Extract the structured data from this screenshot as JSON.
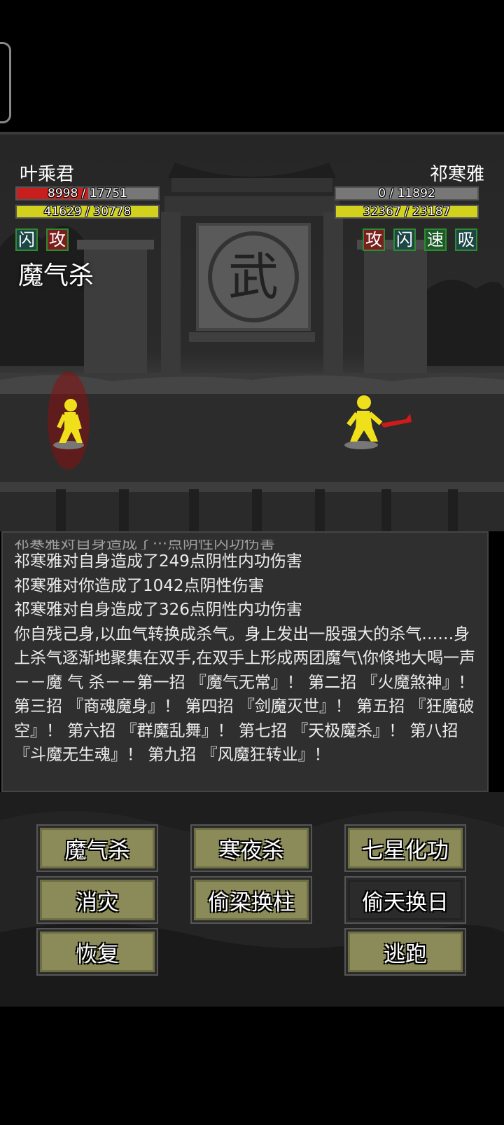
{
  "player": {
    "name": "叶乘君",
    "hp_text": "8998 / 17751",
    "hp_fraction": 0.507,
    "mp_text": "41629 / 30778",
    "mp_fraction": 1.0,
    "buffs": [
      "闪",
      "攻"
    ],
    "current_skill": "魔气杀"
  },
  "enemy": {
    "name": "祁寒雅",
    "hp_text": "0 / 11892",
    "hp_fraction": 0.0,
    "mp_text": "32367 / 23187",
    "mp_fraction": 1.0,
    "buffs": [
      "攻",
      "闪",
      "速",
      "吸"
    ]
  },
  "colors": {
    "hp": "#c81e1e",
    "mp": "#d2d21e",
    "fighter": "#f0e01c",
    "sword": "#d01a1a",
    "button": "#8b8b5a"
  },
  "battle_log": [
    "祁寒雅对自身造成了249点阴性内功伤害",
    "祁寒雅对你造成了1042点阴性伤害",
    "祁寒雅对自身造成了326点阴性内功伤害",
    "你自残己身,以血气转换成杀气。身上发出一股强大的杀气……身上杀气逐渐地聚集在双手,在双手上形成两团魔气\\你倏地大喝一声－－魔 气 杀－－第一招 『魔气无常』！ 第二招 『火魔煞神』！ 第三招 『商魂魔身』！ 第四招 『剑魔灭世』！ 第五招 『狂魔破空』！ 第六招 『群魔乱舞』！ 第七招 『天极魔杀』！ 第八招 『斗魔无生魂』！ 第九招 『风魔狂转业』！"
  ],
  "actions": {
    "mo_qi_sha": "魔气杀",
    "han_ye_sha": "寒夜杀",
    "qi_xing_hua_gong": "七星化功",
    "xiao_zai": "消灾",
    "tou_liang_huan_zhu": "偷梁换柱",
    "tou_tian_huan_ri": "偷天换日",
    "hui_fu": "恢复",
    "tao_pao": "逃跑"
  },
  "emblem_char": "武"
}
